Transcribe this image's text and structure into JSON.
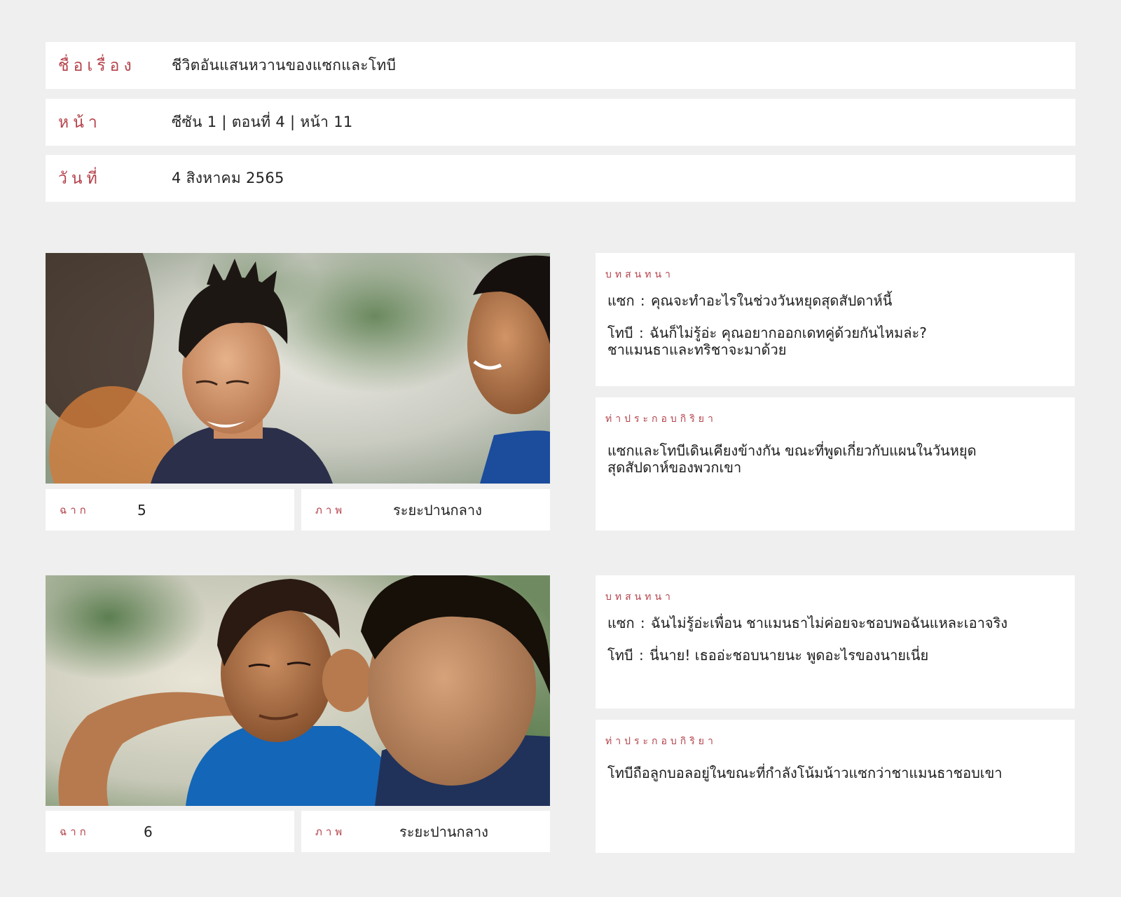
{
  "header": {
    "title_label": "ชื่อเรื่อง",
    "title_value": "ชีวิตอันแสนหวานของแซกและโทบี",
    "page_label": "หน้า",
    "page_value": "ซีซัน 1 | ตอนที่ 4 | หน้า 11",
    "date_label": "วันที่",
    "date_value": "4 สิงหาคม 2565"
  },
  "scenes": [
    {
      "scene_label": "ฉาก",
      "scene_number": "5",
      "shot_label": "ภาพ",
      "shot_value": "ระยะปานกลาง",
      "dialogue_label": "บทสนทนา",
      "dialogue": [
        {
          "speaker": "แซก",
          "line": "คุณจะทำอะไรในช่วงวันหยุดสุดสัปดาห์นี้"
        },
        {
          "speaker": "โทบี",
          "line": "ฉันก็ไม่รู้อ่ะ คุณอยากออกเดทคู่ด้วยกันไหมล่ะ?",
          "line2": "ชาแมนธาและทริชาจะมาด้วย"
        }
      ],
      "action_label": "ท่าประกอบกิริยา",
      "action_line1": "แซกและโทบีเดินเคียงข้างกัน ขณะที่พูดเกี่ยวกับแผนในวันหยุด",
      "action_line2": "สุดสัปดาห์ของพวกเขา"
    },
    {
      "scene_label": "ฉาก",
      "scene_number": "6",
      "shot_label": "ภาพ",
      "shot_value": "ระยะปานกลาง",
      "dialogue_label": "บทสนทนา",
      "dialogue": [
        {
          "speaker": "แซก",
          "line": "ฉันไม่รู้อ่ะเพื่อน ชาแมนธาไม่ค่อยจะชอบพอฉันแหละเอาจริง"
        },
        {
          "speaker": "โทบี",
          "line": "นี่นาย! เธออ่ะชอบนายนะ พูดอะไรของนายเนี่ย"
        }
      ],
      "action_label": "ท่าประกอบกิริยา",
      "action_line1": "โทบีถือลูกบอลอยู่ในขณะที่กำลังโน้มน้าวแซกว่าชาแมนธาชอบเขา"
    }
  ],
  "colors": {
    "accent": "#b5434c",
    "background": "#efefef",
    "panel": "#ffffff"
  }
}
